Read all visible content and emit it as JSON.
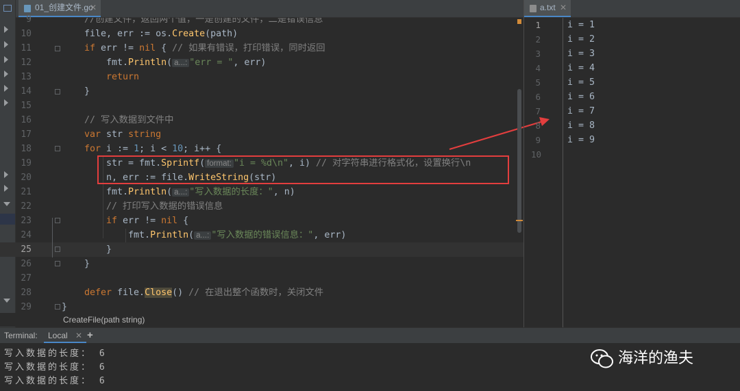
{
  "editor": {
    "tab_label": "01_创建文件.go",
    "breadcrumb": "CreateFile(path string)",
    "lines": [
      {
        "no": "9",
        "code": [
          {
            "t": "//创建文件，返回两个值，一是创建的文件，二是错误信息",
            "c": "cm"
          }
        ]
      },
      {
        "no": "10",
        "code": [
          {
            "t": "file, err := os.",
            "c": ""
          },
          {
            "t": "Create",
            "c": "fn"
          },
          {
            "t": "(path)",
            "c": ""
          }
        ]
      },
      {
        "no": "11",
        "code": [
          {
            "t": "if",
            "c": "kw"
          },
          {
            "t": " err != ",
            "c": ""
          },
          {
            "t": "nil",
            "c": "kw"
          },
          {
            "t": " { ",
            "c": ""
          },
          {
            "t": "// 如果有错误，打印错误，同时返回",
            "c": "cm"
          }
        ]
      },
      {
        "no": "12",
        "code": [
          {
            "t": "    fmt.",
            "c": ""
          },
          {
            "t": "Println",
            "c": "fn"
          },
          {
            "t": "(",
            "c": ""
          },
          {
            "t": "a...:",
            "c": "hint"
          },
          {
            "t": "\"err = \"",
            "c": "st"
          },
          {
            "t": ", err)",
            "c": ""
          }
        ]
      },
      {
        "no": "13",
        "code": [
          {
            "t": "    return",
            "c": "kw"
          }
        ]
      },
      {
        "no": "14",
        "code": [
          {
            "t": "}",
            "c": ""
          }
        ]
      },
      {
        "no": "15",
        "code": []
      },
      {
        "no": "16",
        "code": [
          {
            "t": "// 写入数据到文件中",
            "c": "cm"
          }
        ]
      },
      {
        "no": "17",
        "code": [
          {
            "t": "var",
            "c": "kw"
          },
          {
            "t": " str ",
            "c": ""
          },
          {
            "t": "string",
            "c": "kw"
          }
        ]
      },
      {
        "no": "18",
        "code": [
          {
            "t": "for",
            "c": "kw"
          },
          {
            "t": " i := ",
            "c": ""
          },
          {
            "t": "1",
            "c": "nm"
          },
          {
            "t": "; i < ",
            "c": ""
          },
          {
            "t": "10",
            "c": "nm"
          },
          {
            "t": "; i++ {",
            "c": ""
          }
        ]
      },
      {
        "no": "19",
        "code": [
          {
            "t": "    str = fmt.",
            "c": ""
          },
          {
            "t": "Sprintf",
            "c": "fn"
          },
          {
            "t": "(",
            "c": ""
          },
          {
            "t": "format:",
            "c": "hint"
          },
          {
            "t": "\"i = %d\\n\"",
            "c": "st"
          },
          {
            "t": ", i) ",
            "c": ""
          },
          {
            "t": "// 对字符串进行格式化，设置换行\\n",
            "c": "cm"
          }
        ]
      },
      {
        "no": "20",
        "code": [
          {
            "t": "    n, err := file.",
            "c": ""
          },
          {
            "t": "WriteString",
            "c": "fn"
          },
          {
            "t": "(str)",
            "c": ""
          }
        ]
      },
      {
        "no": "21",
        "code": [
          {
            "t": "    fmt.",
            "c": ""
          },
          {
            "t": "Println",
            "c": "fn"
          },
          {
            "t": "(",
            "c": ""
          },
          {
            "t": "a...:",
            "c": "hint"
          },
          {
            "t": "\"写入数据的长度：\"",
            "c": "st"
          },
          {
            "t": ", n)",
            "c": ""
          }
        ]
      },
      {
        "no": "22",
        "code": [
          {
            "t": "    // 打印写入数据的错误信息",
            "c": "cm"
          }
        ]
      },
      {
        "no": "23",
        "code": [
          {
            "t": "    if",
            "c": "kw"
          },
          {
            "t": " err != ",
            "c": ""
          },
          {
            "t": "nil",
            "c": "kw"
          },
          {
            "t": " {",
            "c": ""
          }
        ]
      },
      {
        "no": "24",
        "code": [
          {
            "t": "        fmt.",
            "c": ""
          },
          {
            "t": "Println",
            "c": "fn"
          },
          {
            "t": "(",
            "c": ""
          },
          {
            "t": "a...:",
            "c": "hint"
          },
          {
            "t": "\"写入数据的错误信息：\"",
            "c": "st"
          },
          {
            "t": ", err)",
            "c": ""
          }
        ]
      },
      {
        "no": "25",
        "code": [
          {
            "t": "    }",
            "c": ""
          }
        ]
      },
      {
        "no": "26",
        "code": [
          {
            "t": "}",
            "c": ""
          }
        ]
      },
      {
        "no": "27",
        "code": []
      },
      {
        "no": "28",
        "code": [
          {
            "t": "defer",
            "c": "kw"
          },
          {
            "t": " file.",
            "c": ""
          },
          {
            "t": "Close",
            "c": "fn defn"
          },
          {
            "t": "() ",
            "c": ""
          },
          {
            "t": "// 在退出整个函数时，关闭文件",
            "c": "cm"
          }
        ]
      },
      {
        "no": "29",
        "code": [
          {
            "t": "}",
            "c": "fb"
          }
        ]
      }
    ]
  },
  "output_file": {
    "tab_label": "a.txt",
    "lines": [
      {
        "no": "1",
        "text": "i = 1"
      },
      {
        "no": "2",
        "text": "i = 2"
      },
      {
        "no": "3",
        "text": "i = 3"
      },
      {
        "no": "4",
        "text": "i = 4"
      },
      {
        "no": "5",
        "text": "i = 5"
      },
      {
        "no": "6",
        "text": "i = 6"
      },
      {
        "no": "7",
        "text": "i = 7"
      },
      {
        "no": "8",
        "text": "i = 8"
      },
      {
        "no": "9",
        "text": "i = 9"
      },
      {
        "no": "10",
        "text": ""
      }
    ]
  },
  "terminal": {
    "title": "Terminal:",
    "tab_label": "Local",
    "add_symbol": "+",
    "lines": [
      "写入数据的长度： 6",
      "写入数据的长度： 6",
      "写入数据的长度： 6"
    ]
  },
  "watermark": {
    "text": "海洋的渔夫"
  },
  "colors": {
    "background": "#2b2b2b",
    "keyword": "#cc7832",
    "function": "#ffc66d",
    "string": "#6a8759",
    "comment": "#808080",
    "number": "#6897bb",
    "annotation_red": "#e33e3e"
  }
}
